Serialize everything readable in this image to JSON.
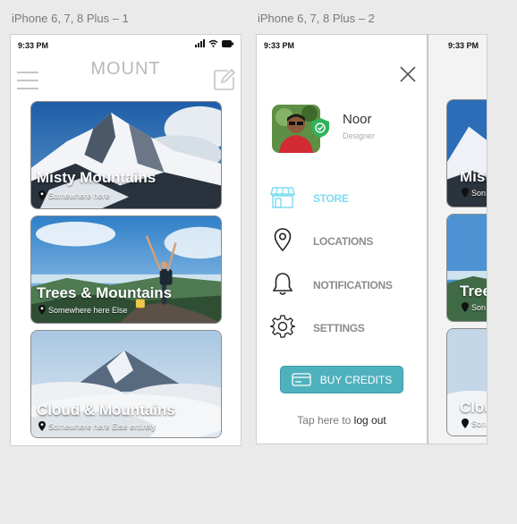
{
  "artboards": {
    "one": "iPhone 6, 7, 8 Plus – 1",
    "two": "iPhone 6, 7, 8 Plus – 2"
  },
  "status": {
    "time": "9:33 PM"
  },
  "header": {
    "title": "MOUNT",
    "menu_icon": "hamburger-icon",
    "edit_icon": "edit-icon"
  },
  "cards": [
    {
      "title": "Misty Mountains",
      "location": "Somewhere here"
    },
    {
      "title": "Trees & Mountains",
      "location": "Somewhere here Else"
    },
    {
      "title": "Cloud & Mountains",
      "location": "Somewhere here Else entirely"
    }
  ],
  "menu": {
    "user": {
      "name": "Noor",
      "role": "Designer"
    },
    "items": [
      {
        "label": "STORE",
        "icon": "store-icon",
        "active": true
      },
      {
        "label": "LOCATIONS",
        "icon": "location-pin-icon",
        "active": false
      },
      {
        "label": "NOTIFICATIONS",
        "icon": "bell-icon",
        "active": false
      },
      {
        "label": "SETTINGS",
        "icon": "gear-icon",
        "active": false
      }
    ],
    "buy_label": "BUY CREDITS",
    "logout_prefix": "Tap here to",
    "logout_link": "log out"
  },
  "partial": {
    "card_titles": [
      "Mist",
      "Tree",
      "Clou"
    ],
    "card_locs": [
      "Son",
      "Son",
      "Son"
    ]
  },
  "colors": {
    "accent": "#4fb1bd",
    "active_menu": "#7fdcf0",
    "header_gray": "#b9b9b9"
  }
}
